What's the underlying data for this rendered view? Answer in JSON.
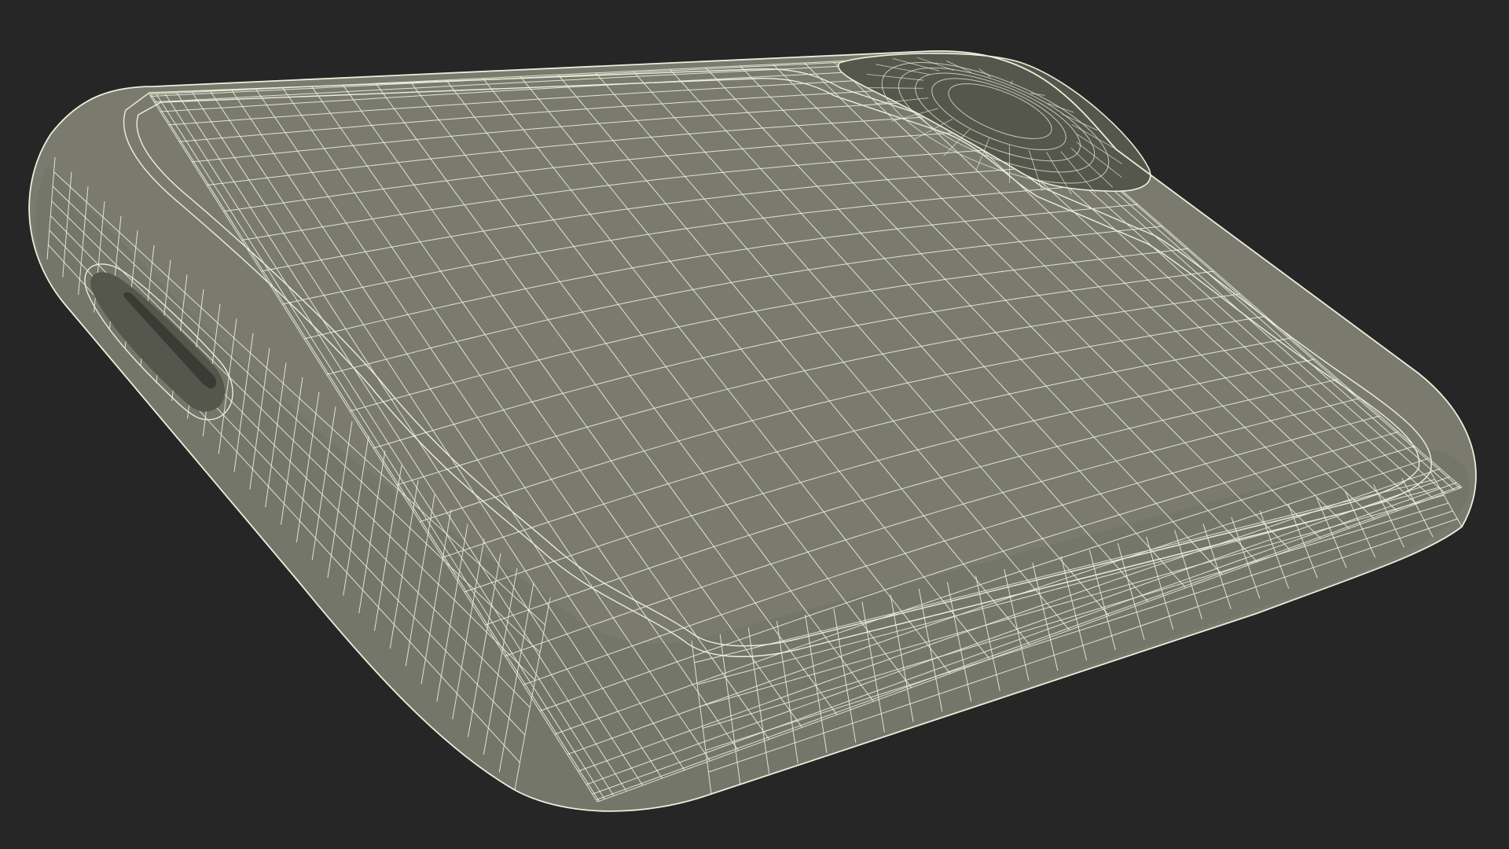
{
  "scene": {
    "background_color": "#262626",
    "surface_color": "#7a7b6e",
    "surface_shadow_color": "#6b6c60",
    "wire_color": "#ecefdc",
    "cavity_color": "#55564c",
    "slot_color": "#3a3b35",
    "object": "wireframe-rounded-case",
    "render_mode": "wireframe-over-shaded"
  }
}
